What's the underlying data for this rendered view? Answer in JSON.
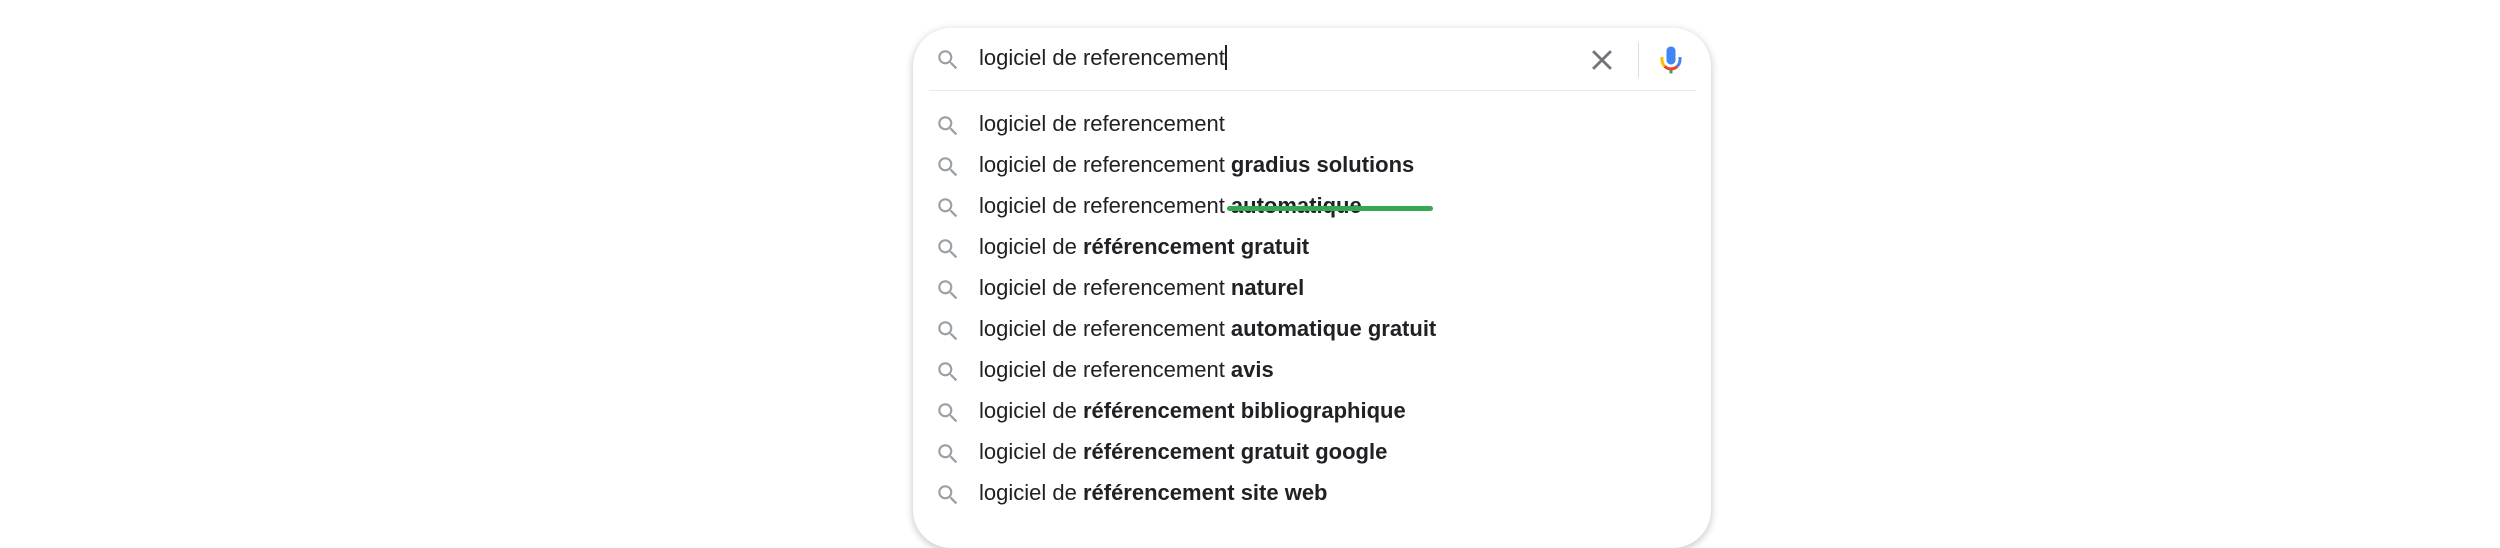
{
  "search": {
    "query": "logiciel de referencement",
    "icon": "search-icon",
    "clear_icon": "close-icon",
    "mic_icon": "microphone-icon"
  },
  "suggestions": [
    {
      "prefix": "logiciel de referencement",
      "suffix": ""
    },
    {
      "prefix": "logiciel de referencement ",
      "suffix": "gradius solutions"
    },
    {
      "prefix": "logiciel de referencement ",
      "suffix": "automatique"
    },
    {
      "prefix": "logiciel de ",
      "suffix": "référencement gratuit"
    },
    {
      "prefix": "logiciel de referencement ",
      "suffix": "naturel"
    },
    {
      "prefix": "logiciel de referencement ",
      "suffix": "automatique gratuit"
    },
    {
      "prefix": "logiciel de referencement ",
      "suffix": "avis"
    },
    {
      "prefix": "logiciel de ",
      "suffix": "référencement bibliographique"
    },
    {
      "prefix": "logiciel de ",
      "suffix": "référencement gratuit google"
    },
    {
      "prefix": "logiciel de ",
      "suffix": "référencement site web"
    }
  ],
  "colors": {
    "highlight_underline": "#34a853",
    "mic_blue": "#4285f4",
    "mic_red": "#ea4335",
    "mic_yellow": "#fbbc04",
    "mic_green": "#34a853"
  }
}
